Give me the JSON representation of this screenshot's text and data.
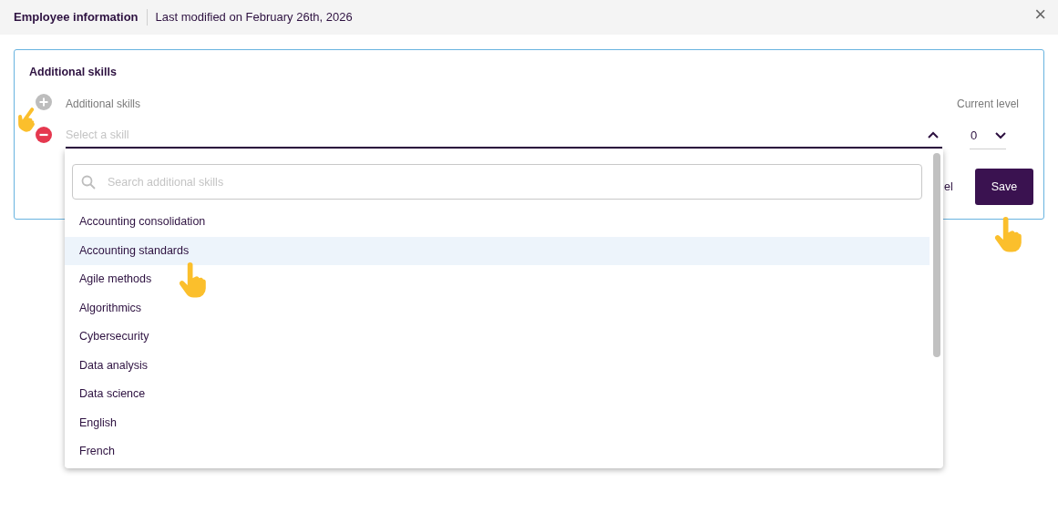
{
  "header": {
    "title": "Employee information",
    "subtitle": "Last modified on February 26th, 2026",
    "close": "×"
  },
  "card": {
    "title": "Additional skills",
    "skill_label": "Additional skills",
    "level_label": "Current level",
    "skill_select": {
      "placeholder": "Select a skill",
      "expanded": true
    },
    "level_select": {
      "value": "0"
    },
    "cancel_fragment": "el",
    "save": "Save"
  },
  "dropdown": {
    "search_placeholder": "Search additional skills",
    "items": [
      {
        "label": "Accounting consolidation",
        "selected": false
      },
      {
        "label": "Accounting standards",
        "selected": true
      },
      {
        "label": "Agile methods",
        "selected": false
      },
      {
        "label": "Algorithmics",
        "selected": false
      },
      {
        "label": "Cybersecurity",
        "selected": false
      },
      {
        "label": "Data analysis",
        "selected": false
      },
      {
        "label": "Data science",
        "selected": false
      },
      {
        "label": "English",
        "selected": false
      },
      {
        "label": "French",
        "selected": false
      }
    ]
  }
}
